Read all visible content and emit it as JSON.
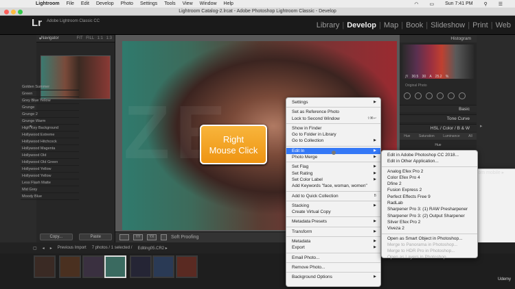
{
  "macos_menu": {
    "app": "Lightroom",
    "items": [
      "File",
      "Edit",
      "Develop",
      "Photo",
      "Settings",
      "Tools",
      "View",
      "Window",
      "Help"
    ],
    "clock": "Sun 7:41 PM"
  },
  "window_title": "Lightroom Catalog-2.lrcat - Adobe Photoshop Lightroom Classic - Develop",
  "identity_plate": {
    "logo": "Lr",
    "line1": "Adobe Lightroom Classic CC",
    "line2": "Get started with Lightroom mobile ▸"
  },
  "modules": {
    "items": [
      "Library",
      "Develop",
      "Map",
      "Book",
      "Slideshow",
      "Print",
      "Web"
    ],
    "active": "Develop"
  },
  "navigator": {
    "title": "Navigator",
    "zoom_options": "FIT  FILL  1:1  1:3"
  },
  "presets": [
    "Golden Summer",
    "Green",
    "Grey Blue Yellow",
    "Grunge",
    "Grunge 2",
    "Grunge Warm",
    "High Key Background",
    "Hollywood Extreme",
    "Hollywood Hitchcock",
    "Hollywood Magenta",
    "Hollywood Old",
    "Hollywood Old Green",
    "Hollywood Yellow",
    "Hollywood Yellow",
    "Less Flash Matte",
    "Mid Grey",
    "Moody Blue"
  ],
  "left_buttons": {
    "copy": "Copy...",
    "paste": "Paste"
  },
  "callout": {
    "line1": "Right",
    "line2": "Mouse Click"
  },
  "toolbar": {
    "soft_proofing": "Soft Proofing"
  },
  "right_panel": {
    "histogram": "Histogram",
    "hist_values": "ƒ/  30.5   30 A   25.2 %",
    "original_photo": "Original Photo",
    "basic": "Basic",
    "tone_curve": "Tone Curve",
    "hsl": "HSL / Color / B & W",
    "hsl_tabs": [
      "Hue",
      "Saturation",
      "Luminance",
      "All"
    ],
    "hue": "Hue"
  },
  "filmstrip": {
    "source": "Previous Import",
    "count": "7 photos / 1 selected /",
    "file": "Editing05.CR2 ▸"
  },
  "context_menu": [
    {
      "label": "Settings",
      "arrow": true
    },
    {
      "sep": true
    },
    {
      "label": "Set as Reference Photo"
    },
    {
      "label": "Lock to Second Window",
      "shortcut": "⇧⌘↩"
    },
    {
      "sep": true
    },
    {
      "label": "Show in Finder"
    },
    {
      "label": "Go to Folder in Library"
    },
    {
      "label": "Go to Collection",
      "arrow": true
    },
    {
      "sep": true
    },
    {
      "label": "Edit In",
      "arrow": true,
      "highlight": true
    },
    {
      "label": "Photo Merge",
      "arrow": true
    },
    {
      "sep": true
    },
    {
      "label": "Set Flag",
      "arrow": true
    },
    {
      "label": "Set Rating",
      "arrow": true
    },
    {
      "label": "Set Color Label",
      "arrow": true
    },
    {
      "label": "Add Keywords \"face, woman, women\""
    },
    {
      "sep": true
    },
    {
      "label": "Add to Quick Collection",
      "shortcut": "B"
    },
    {
      "sep": true
    },
    {
      "label": "Stacking",
      "arrow": true
    },
    {
      "label": "Create Virtual Copy"
    },
    {
      "sep": true
    },
    {
      "label": "Metadata Presets",
      "arrow": true
    },
    {
      "sep": true
    },
    {
      "label": "Transform",
      "arrow": true
    },
    {
      "sep": true
    },
    {
      "label": "Metadata",
      "arrow": true
    },
    {
      "label": "Export",
      "arrow": true
    },
    {
      "sep": true
    },
    {
      "label": "Email Photo..."
    },
    {
      "sep": true
    },
    {
      "label": "Remove Photo..."
    },
    {
      "sep": true
    },
    {
      "label": "Background Options",
      "arrow": true
    }
  ],
  "submenu": [
    {
      "label": "Edit in Adobe Photoshop CC 2018..."
    },
    {
      "label": "Edit in Other Application..."
    },
    {
      "sep": true
    },
    {
      "label": "Analog Efex Pro 2"
    },
    {
      "label": "Color Efex Pro 4"
    },
    {
      "label": "Dfine 2"
    },
    {
      "label": "Fusion Express 2"
    },
    {
      "label": "Perfect Effects Free 9"
    },
    {
      "label": "RadLab"
    },
    {
      "label": "Sharpener Pro 3: (1) RAW Presharpener"
    },
    {
      "label": "Sharpener Pro 3: (2) Output Sharpener"
    },
    {
      "label": "Silver Efex Pro 2"
    },
    {
      "label": "Viveza 2"
    },
    {
      "sep": true
    },
    {
      "label": "Open as Smart Object in Photoshop..."
    },
    {
      "label": "Merge to Panorama in Photoshop...",
      "disabled": true
    },
    {
      "label": "Merge to HDR Pro in Photoshop...",
      "disabled": true
    },
    {
      "label": "Open as Layers in Photoshop...",
      "disabled": true
    }
  ],
  "udemy": "Udemy",
  "watermark": "ZE"
}
